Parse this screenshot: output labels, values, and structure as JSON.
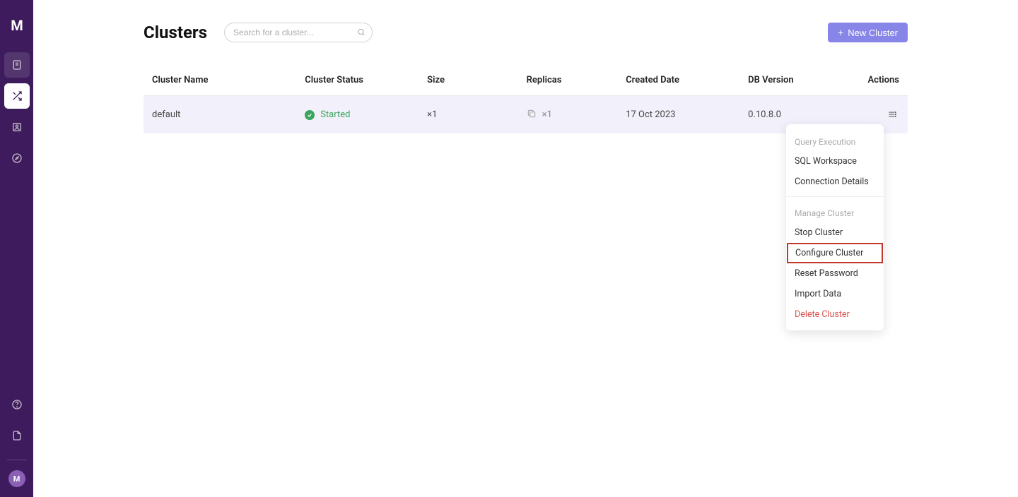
{
  "sidebar": {
    "logo": "M",
    "avatar_initial": "M",
    "nav_items": [
      {
        "name": "database-icon"
      },
      {
        "name": "clusters-icon"
      },
      {
        "name": "contacts-icon"
      },
      {
        "name": "compass-icon"
      }
    ],
    "bottom_items": [
      {
        "name": "help-icon"
      },
      {
        "name": "docs-icon"
      }
    ]
  },
  "header": {
    "title": "Clusters",
    "search_placeholder": "Search for a cluster...",
    "new_cluster_label": "New Cluster"
  },
  "table": {
    "columns": [
      "Cluster Name",
      "Cluster Status",
      "Size",
      "Replicas",
      "Created Date",
      "DB Version",
      "Actions"
    ],
    "rows": [
      {
        "name": "default",
        "status": "Started",
        "size": "×1",
        "replicas": "×1",
        "created": "17 Oct 2023",
        "version": "0.10.8.0"
      }
    ]
  },
  "dropdown": {
    "section1_title": "Query Execution",
    "section1_items": [
      "SQL Workspace",
      "Connection Details"
    ],
    "section2_title": "Manage Cluster",
    "section2_items": [
      "Stop Cluster",
      "Configure Cluster",
      "Reset Password",
      "Import Data",
      "Delete Cluster"
    ],
    "highlighted_item": "Configure Cluster",
    "danger_item": "Delete Cluster"
  }
}
